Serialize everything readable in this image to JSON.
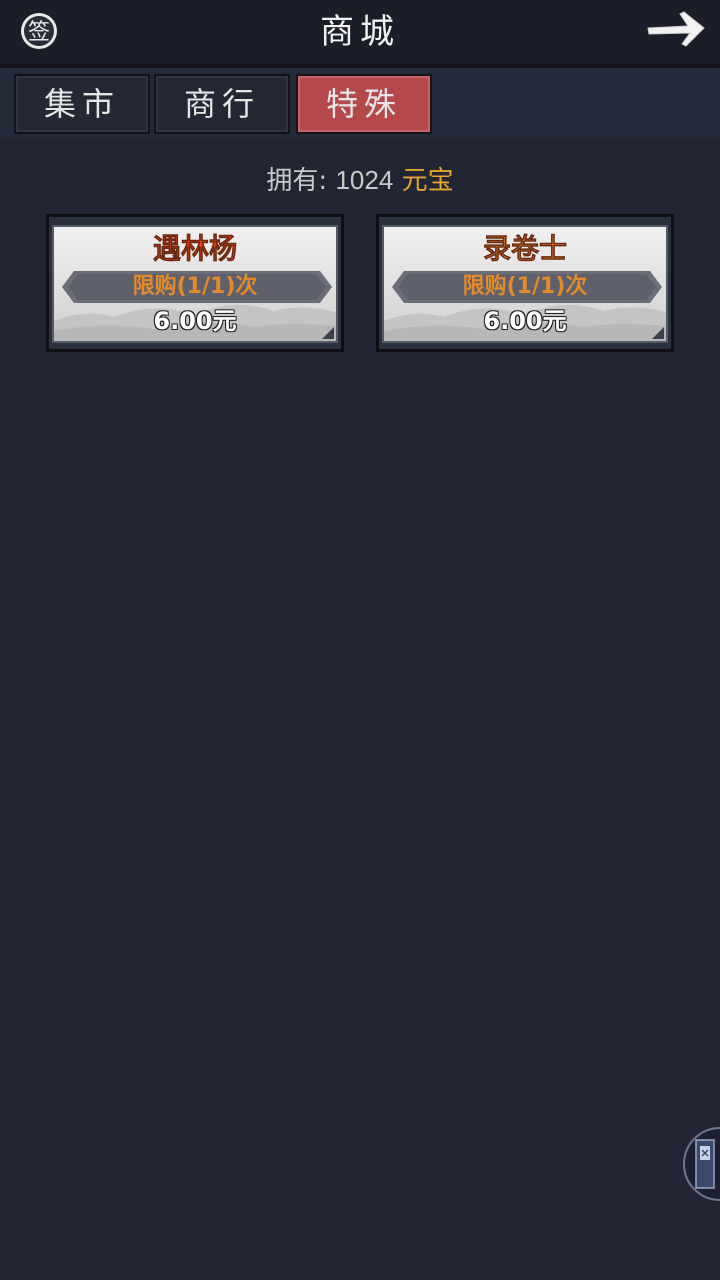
{
  "header": {
    "title": "商城",
    "sign_icon": "sign-in-icon",
    "back_icon": "arrow-right-icon"
  },
  "tabs": [
    {
      "label": "集市",
      "active": false
    },
    {
      "label": "商行",
      "active": false
    },
    {
      "label": "特殊",
      "active": true
    }
  ],
  "currency": {
    "label": "拥有:",
    "amount": "1024",
    "unit": "元宝"
  },
  "items": [
    {
      "name": "遇林杨",
      "name_color": "#ff3a10",
      "limit": "限购(1/1)次",
      "price": "6.00元"
    },
    {
      "name": "录卷士",
      "name_color": "#ef8a28",
      "limit": "限购(1/1)次",
      "price": "6.00元"
    }
  ],
  "colors": {
    "background": "#222634",
    "active_tab": "#b4484a",
    "currency_unit": "#e3a42b"
  }
}
